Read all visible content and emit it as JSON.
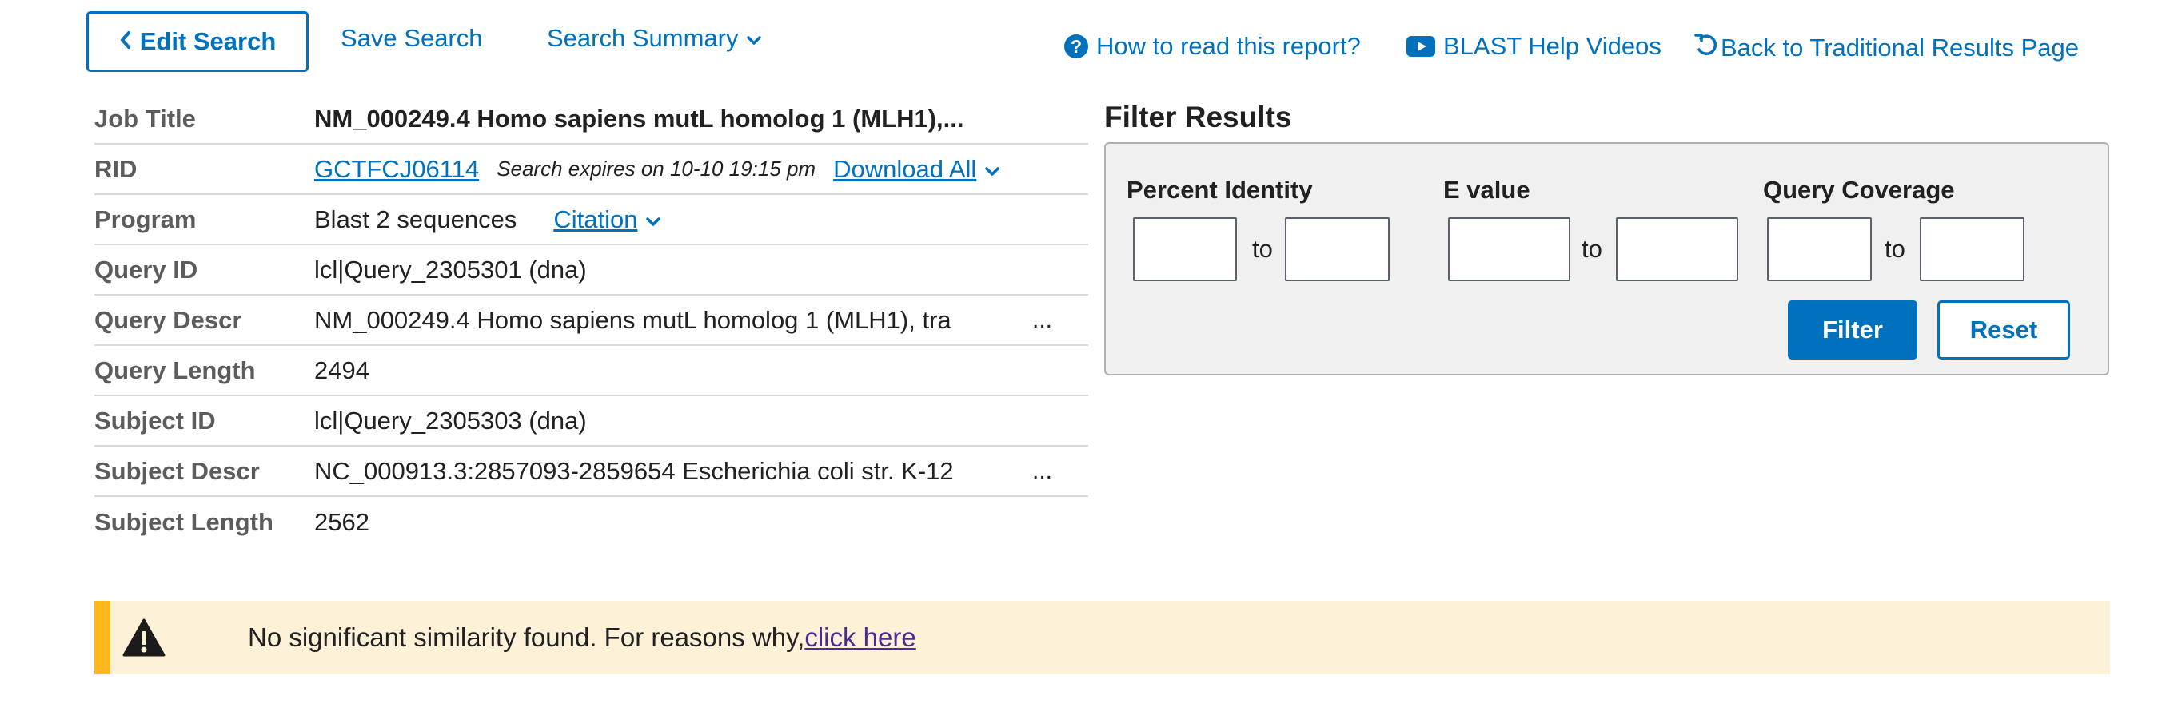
{
  "toolbar": {
    "edit_search": "Edit Search",
    "save_search": "Save Search",
    "search_summary": "Search Summary",
    "how_to_read": "How to read this report?",
    "help_videos": "BLAST Help Videos",
    "back_traditional": "Back to Traditional Results Page"
  },
  "info": {
    "job_title_label": "Job Title",
    "job_title_value": "NM_000249.4 Homo sapiens mutL homolog 1 (MLH1),...",
    "rid_label": "RID",
    "rid_value": "GCTFCJ06114",
    "rid_expires": "Search expires on 10-10 19:15 pm",
    "download_all": "Download All",
    "program_label": "Program",
    "program_value": "Blast 2 sequences",
    "citation": "Citation",
    "query_id_label": "Query ID",
    "query_id_value": "lcl|Query_2305301 (dna)",
    "query_descr_label": "Query Descr",
    "query_descr_value": "NM_000249.4 Homo sapiens mutL homolog 1 (MLH1), tra",
    "query_length_label": "Query Length",
    "query_length_value": "2494",
    "subject_id_label": "Subject ID",
    "subject_id_value": "lcl|Query_2305303 (dna)",
    "subject_descr_label": "Subject Descr",
    "subject_descr_value": "NC_000913.3:2857093-2859654 Escherichia coli str. K-12",
    "subject_length_label": "Subject Length",
    "subject_length_value": "2562",
    "ellipsis": "..."
  },
  "filter": {
    "heading": "Filter Results",
    "percent_identity": "Percent Identity",
    "e_value": "E value",
    "query_coverage": "Query Coverage",
    "to": "to",
    "filter_button": "Filter",
    "reset_button": "Reset"
  },
  "alert": {
    "message": "No significant similarity found. For reasons why,",
    "link": "click here"
  },
  "colors": {
    "accent": "#0071bc",
    "alert_bg": "#fdf1d8",
    "alert_border": "#fdb81e",
    "visited_link": "#4c2c92"
  },
  "icons": {
    "edit_search": "chevron-left-icon",
    "dropdowns": "chevron-down-icon",
    "help": "question-circle-icon",
    "videos": "youtube-icon",
    "back": "undo-arrow-icon",
    "alert": "warning-triangle-icon"
  }
}
